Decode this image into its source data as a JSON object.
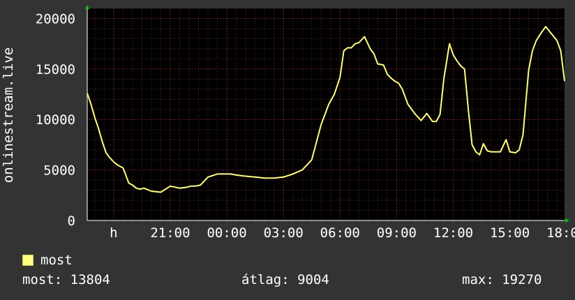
{
  "chart_data": {
    "type": "line",
    "ylabel": "onlinestream.live",
    "ylim": [
      0,
      21000
    ],
    "yticks": [
      0,
      5000,
      10000,
      15000,
      20000
    ],
    "ytick_labels": [
      "0",
      "5000",
      "10000",
      "15000",
      "20000"
    ],
    "xlim": [
      16.6,
      41.9
    ],
    "xtick_labels": [
      {
        "x": 18,
        "label": "h"
      },
      {
        "x": 21,
        "label": "21:00"
      },
      {
        "x": 24,
        "label": "00:00"
      },
      {
        "x": 27,
        "label": "03:00"
      },
      {
        "x": 30,
        "label": "06:00"
      },
      {
        "x": 33,
        "label": "09:00"
      },
      {
        "x": 36,
        "label": "12:00"
      },
      {
        "x": 39,
        "label": "15:00"
      },
      {
        "x": 42,
        "label": "18:00"
      }
    ],
    "grid": true,
    "line_color": "#ffff80",
    "series": [
      {
        "name": "most",
        "x": [
          16.6,
          16.8,
          17.0,
          17.2,
          17.4,
          17.6,
          17.8,
          18.0,
          18.2,
          18.5,
          18.8,
          19.0,
          19.2,
          19.4,
          19.6,
          20.0,
          20.5,
          21.0,
          21.5,
          21.9,
          22.1,
          22.3,
          22.6,
          23.0,
          23.5,
          23.9,
          24.2,
          24.5,
          24.9,
          25.5,
          26.0,
          26.5,
          27.0,
          27.5,
          28.0,
          28.5,
          29.0,
          29.4,
          29.7,
          30.0,
          30.2,
          30.4,
          30.6,
          30.8,
          31.0,
          31.3,
          31.6,
          31.8,
          32.0,
          32.3,
          32.5,
          32.7,
          32.9,
          33.1,
          33.3,
          33.6,
          34.0,
          34.3,
          34.6,
          34.9,
          35.1,
          35.3,
          35.5,
          35.8,
          36.0,
          36.2,
          36.4,
          36.6,
          36.8,
          37.0,
          37.2,
          37.4,
          37.6,
          37.8,
          38.0,
          38.2,
          38.5,
          38.8,
          39.0,
          39.3,
          39.5,
          39.7,
          40.0,
          40.2,
          40.4,
          40.6,
          40.9,
          41.2,
          41.5,
          41.7,
          41.9
        ],
        "y": [
          12600,
          11500,
          10200,
          9100,
          7800,
          6700,
          6200,
          5800,
          5500,
          5200,
          3700,
          3500,
          3200,
          3100,
          3200,
          2900,
          2800,
          3400,
          3200,
          3300,
          3400,
          3400,
          3500,
          4300,
          4600,
          4600,
          4600,
          4500,
          4400,
          4300,
          4200,
          4200,
          4300,
          4600,
          5000,
          6000,
          9500,
          11500,
          12500,
          14200,
          16800,
          17100,
          17100,
          17500,
          17600,
          18200,
          17000,
          16500,
          15500,
          15400,
          14500,
          14100,
          13800,
          13600,
          13000,
          11500,
          10500,
          9900,
          10600,
          9800,
          9800,
          10500,
          14000,
          17500,
          16400,
          15800,
          15300,
          15000,
          11000,
          7500,
          6800,
          6500,
          7600,
          6900,
          6800,
          6800,
          6800,
          8000,
          6800,
          6700,
          7000,
          8500,
          14900,
          16800,
          17800,
          18400,
          19200,
          18500,
          17800,
          16800,
          13800
        ]
      }
    ]
  },
  "legend": {
    "label": "most",
    "color": "#ffff80"
  },
  "stats": {
    "last": "most: 13804",
    "avg": "átlag: 9004",
    "max": "max: 19270"
  }
}
